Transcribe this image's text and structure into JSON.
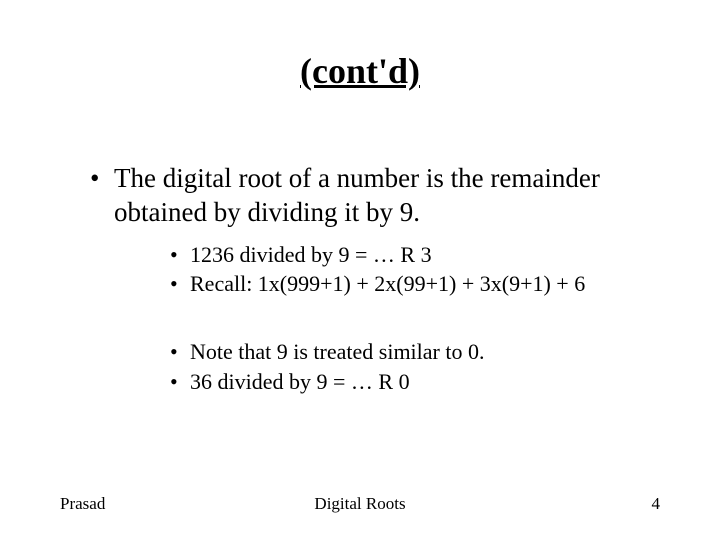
{
  "title": "(cont'd)",
  "bullet1": "The digital root of a number is the remainder obtained by dividing it by 9.",
  "sub1": "1236  divided by 9  =  … R 3",
  "sub2": "Recall: 1x(999+1) + 2x(99+1) + 3x(9+1) + 6",
  "sub3": "Note that 9 is treated similar to 0.",
  "sub4": "36  divided by 9  =  … R 0",
  "footer_left": "Prasad",
  "footer_center": "Digital Roots",
  "footer_right": "4"
}
